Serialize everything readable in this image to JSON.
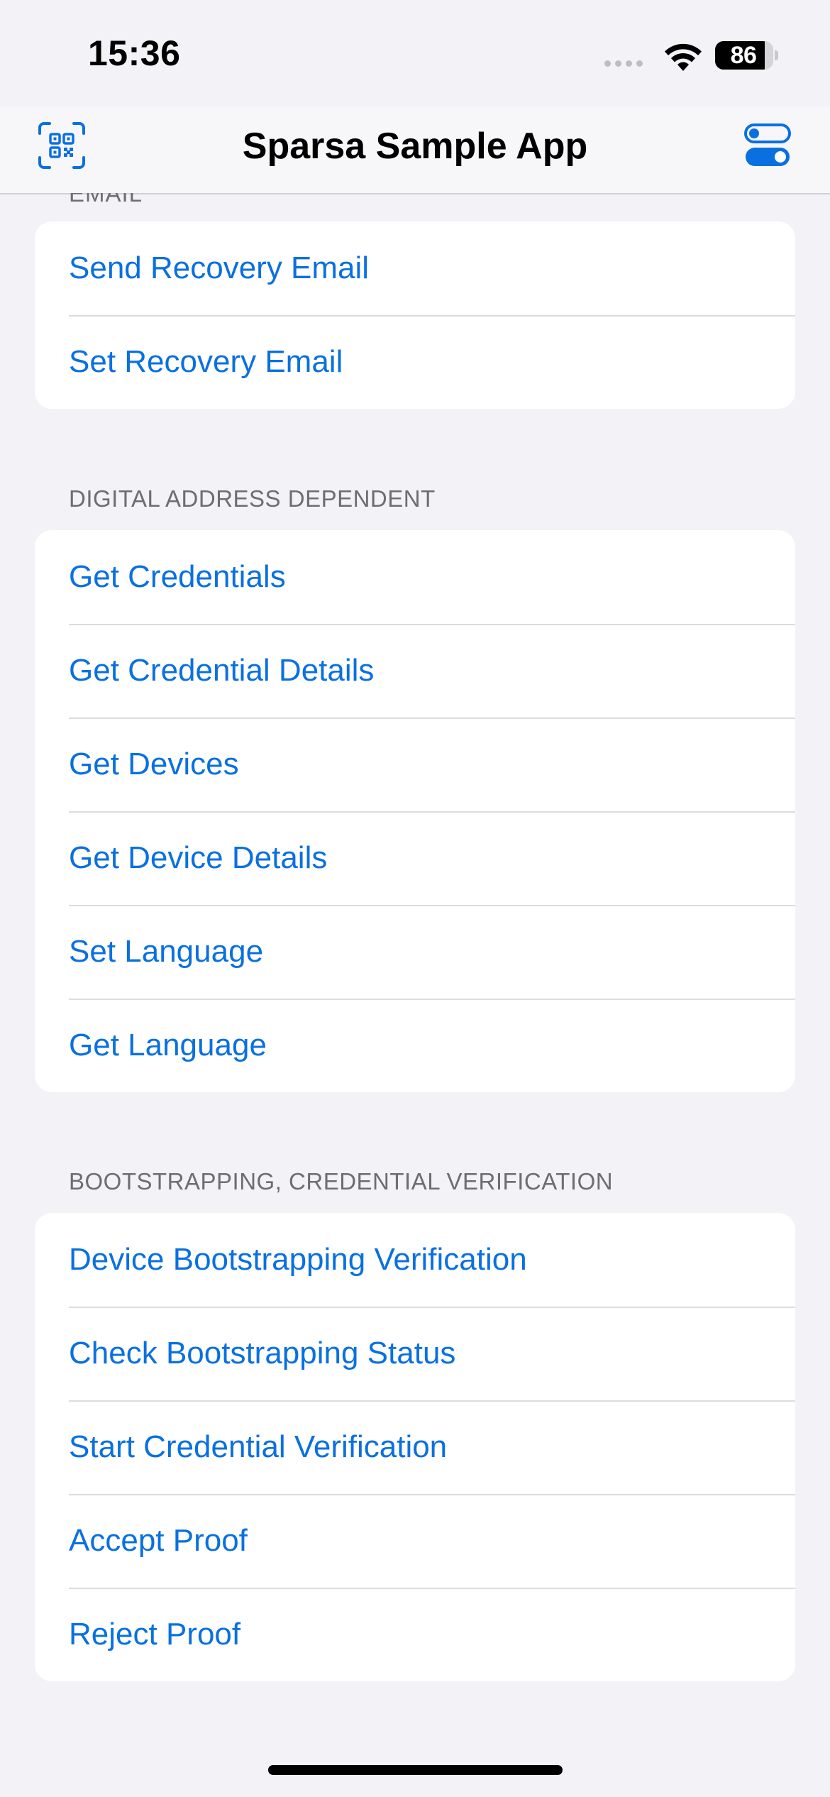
{
  "status_bar": {
    "time": "15:36",
    "battery": "86"
  },
  "nav": {
    "title": "Sparsa Sample App",
    "left_icon": "qr-code-icon",
    "right_icon": "toggle-settings-icon",
    "accent_color": "#0a70e0"
  },
  "sections": {
    "email": {
      "header": "EMAIL",
      "items": [
        "Send Recovery Email",
        "Set Recovery Email"
      ]
    },
    "digital_address": {
      "header": "DIGITAL ADDRESS DEPENDENT",
      "items": [
        "Get Credentials",
        "Get Credential Details",
        "Get Devices",
        "Get Device Details",
        "Set Language",
        "Get Language"
      ]
    },
    "bootstrapping": {
      "header": "BOOTSTRAPPING, CREDENTIAL VERIFICATION",
      "items": [
        "Device Bootstrapping Verification",
        "Check Bootstrapping Status",
        "Start Credential Verification",
        "Accept Proof",
        "Reject Proof"
      ]
    }
  }
}
